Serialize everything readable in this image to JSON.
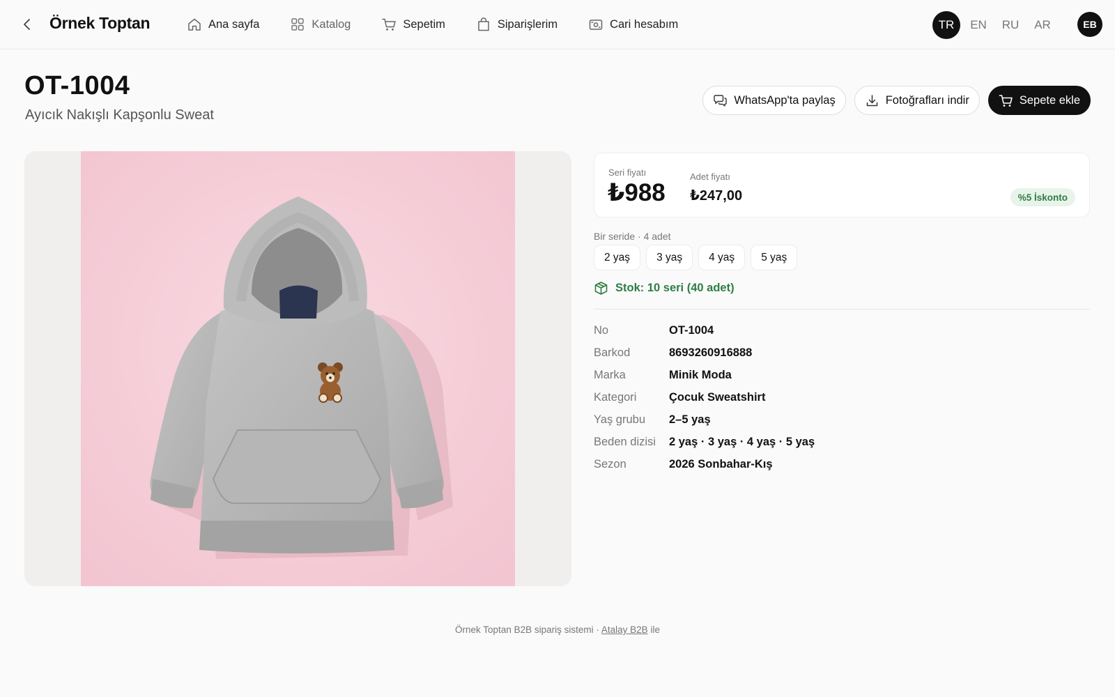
{
  "header": {
    "brand": "Örnek Toptan",
    "nav": [
      {
        "label": "Ana sayfa",
        "icon": "home-icon"
      },
      {
        "label": "Katalog",
        "icon": "grid-icon"
      },
      {
        "label": "Sepetim",
        "icon": "cart-icon"
      },
      {
        "label": "Siparişlerim",
        "icon": "bag-icon"
      },
      {
        "label": "Cari hesabım",
        "icon": "wallet-icon"
      }
    ],
    "languages": [
      "TR",
      "EN",
      "RU",
      "AR"
    ],
    "active_language": "TR",
    "avatar": "EB"
  },
  "product": {
    "code": "OT-1004",
    "name": "Ayıcık Nakışlı Kapşonlu Sweat",
    "actions": {
      "whatsapp": "WhatsApp'ta paylaş",
      "download": "Fotoğrafları indir",
      "add_to_cart": "Sepete ekle"
    },
    "price": {
      "series_label": "Seri fiyatı",
      "series_value": "₺988",
      "unit_label": "Adet fiyatı",
      "unit_value": "₺247,00",
      "discount": "%5 İskonto"
    },
    "series_info": "Bir seride · 4 adet",
    "sizes": [
      "2 yaş",
      "3 yaş",
      "4 yaş",
      "5 yaş"
    ],
    "stock": "Stok: 10 seri (40 adet)",
    "specs": [
      {
        "key": "No",
        "value": "OT-1004"
      },
      {
        "key": "Barkod",
        "value": "8693260916888"
      },
      {
        "key": "Marka",
        "value": "Minik Moda"
      },
      {
        "key": "Kategori",
        "value": "Çocuk Sweatshirt"
      },
      {
        "key": "Yaş grubu",
        "value": "2–5 yaş"
      },
      {
        "key": "Beden dizisi",
        "value": "2 yaş · 3 yaş · 4 yaş · 5 yaş"
      },
      {
        "key": "Sezon",
        "value": "2026 Sonbahar-Kış"
      }
    ]
  },
  "footer": {
    "text": "Örnek Toptan B2B sipariş sistemi ·",
    "link": "Atalay B2B",
    "suffix": "ile"
  },
  "colors": {
    "accent": "#111111",
    "stock_green": "#2e7d44",
    "photo_background": "#f6cfd9"
  }
}
